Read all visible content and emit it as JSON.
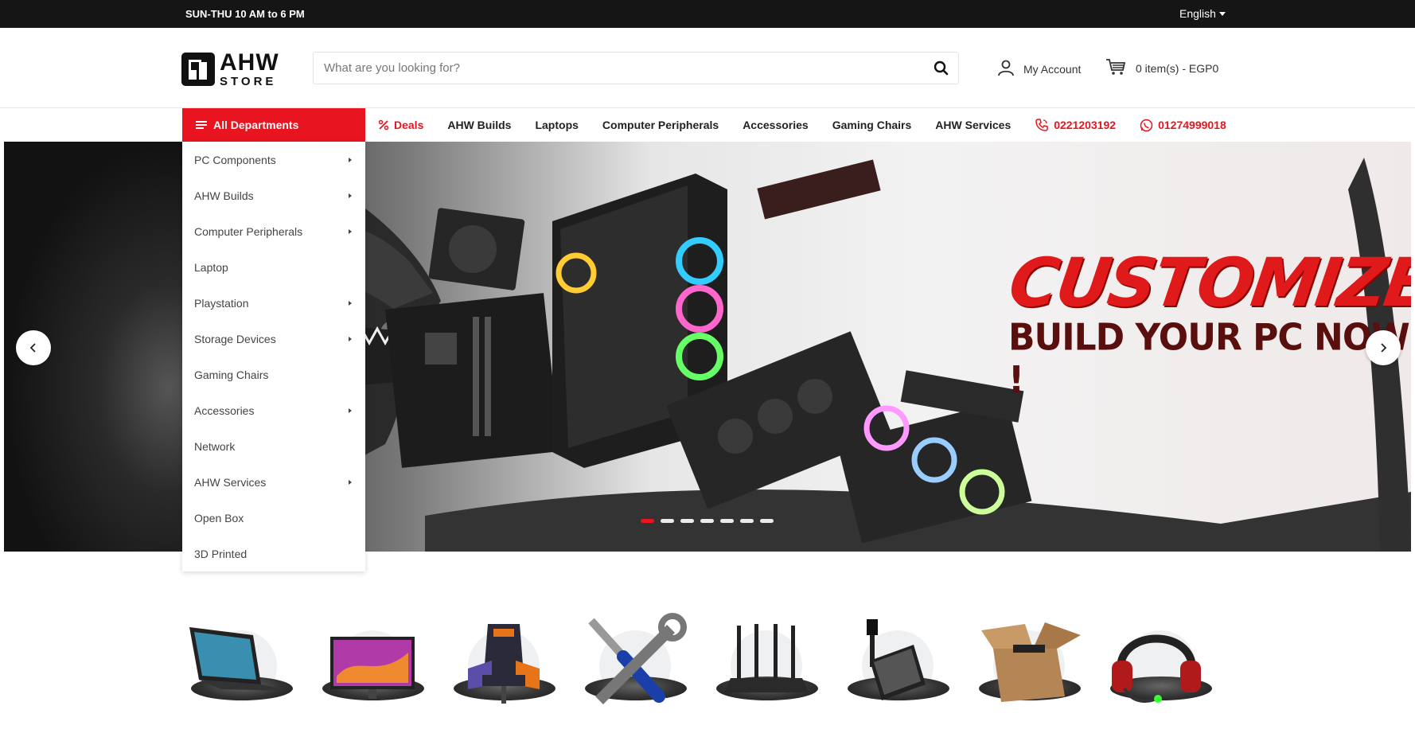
{
  "topbar": {
    "hours": "SUN-THU 10 AM to 6 PM",
    "language": "English"
  },
  "header": {
    "logo_main": "AHW",
    "logo_sub": "STORE",
    "search_placeholder": "What are you looking for?",
    "account_label": "My Account",
    "cart_label": "0 item(s) - EGP0"
  },
  "nav": {
    "all_departments": "All Departments",
    "links": [
      "Deals",
      "AHW Builds",
      "Laptops",
      "Computer Peripherals",
      "Accessories",
      "Gaming Chairs",
      "AHW Services"
    ],
    "phone": "0221203192",
    "whatsapp": "01274999018"
  },
  "departments": [
    {
      "label": "PC Components",
      "has_sub": true
    },
    {
      "label": "AHW Builds",
      "has_sub": true
    },
    {
      "label": "Computer Peripherals",
      "has_sub": true
    },
    {
      "label": "Laptop",
      "has_sub": false
    },
    {
      "label": "Playstation",
      "has_sub": true
    },
    {
      "label": "Storage Devices",
      "has_sub": true
    },
    {
      "label": "Gaming Chairs",
      "has_sub": false
    },
    {
      "label": "Accessories",
      "has_sub": true
    },
    {
      "label": "Network",
      "has_sub": false
    },
    {
      "label": "AHW Services",
      "has_sub": true
    },
    {
      "label": "Open Box",
      "has_sub": false
    },
    {
      "label": "3D Printed",
      "has_sub": false
    }
  ],
  "hero": {
    "headline": "CUSTOMIZE",
    "subline": "BUILD YOUR PC NOW !",
    "slide_count": 7,
    "active_slide": 1
  },
  "colors": {
    "accent": "#e8141f",
    "topbar": "#151515"
  },
  "category_icons": [
    "laptop-icon",
    "monitor-icon",
    "gaming-chair-icon",
    "tools-icon",
    "router-icon",
    "phone-stand-icon",
    "open-box-icon",
    "headset-icon"
  ]
}
